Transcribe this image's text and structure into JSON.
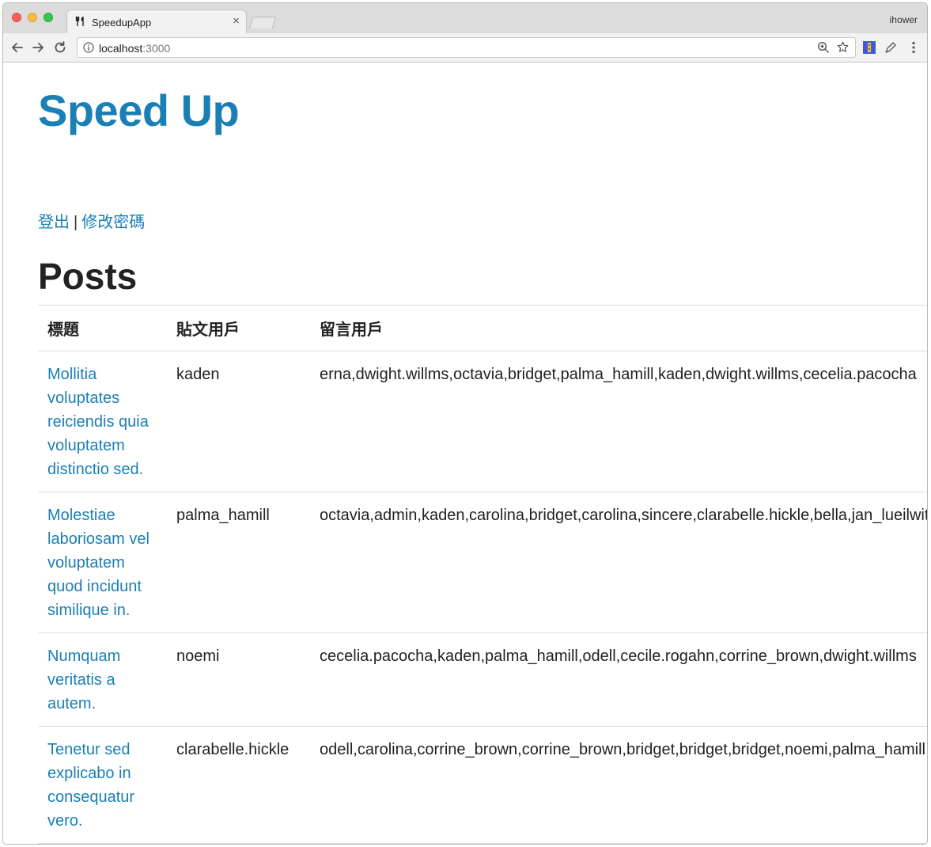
{
  "browser": {
    "tab_title": "SpeedupApp",
    "tab_close": "×",
    "profile_name": "ihower",
    "url_host": "localhost",
    "url_port": ":3000"
  },
  "site": {
    "title": "Speed Up",
    "logout_label": "登出",
    "separator": "|",
    "change_password_label": "修改密碼"
  },
  "posts": {
    "heading": "Posts",
    "columns": [
      "標題",
      "貼文用戶",
      "留言用戶"
    ],
    "rows": [
      {
        "title": "Mollitia voluptates reiciendis quia voluptatem distinctio sed.",
        "author": "kaden",
        "commenters": "erna,dwight.willms,octavia,bridget,palma_hamill,kaden,dwight.willms,cecelia.pacocha"
      },
      {
        "title": "Molestiae laboriosam vel voluptatem quod incidunt similique in.",
        "author": "palma_hamill",
        "commenters": "octavia,admin,kaden,carolina,bridget,carolina,sincere,clarabelle.hickle,bella,jan_lueilwitz"
      },
      {
        "title": "Numquam veritatis a autem.",
        "author": "noemi",
        "commenters": "cecelia.pacocha,kaden,palma_hamill,odell,cecile.rogahn,corrine_brown,dwight.willms"
      },
      {
        "title": "Tenetur sed explicabo in consequatur vero.",
        "author": "clarabelle.hickle",
        "commenters": "odell,carolina,corrine_brown,corrine_brown,bridget,bridget,bridget,noemi,palma_hamill"
      }
    ]
  }
}
